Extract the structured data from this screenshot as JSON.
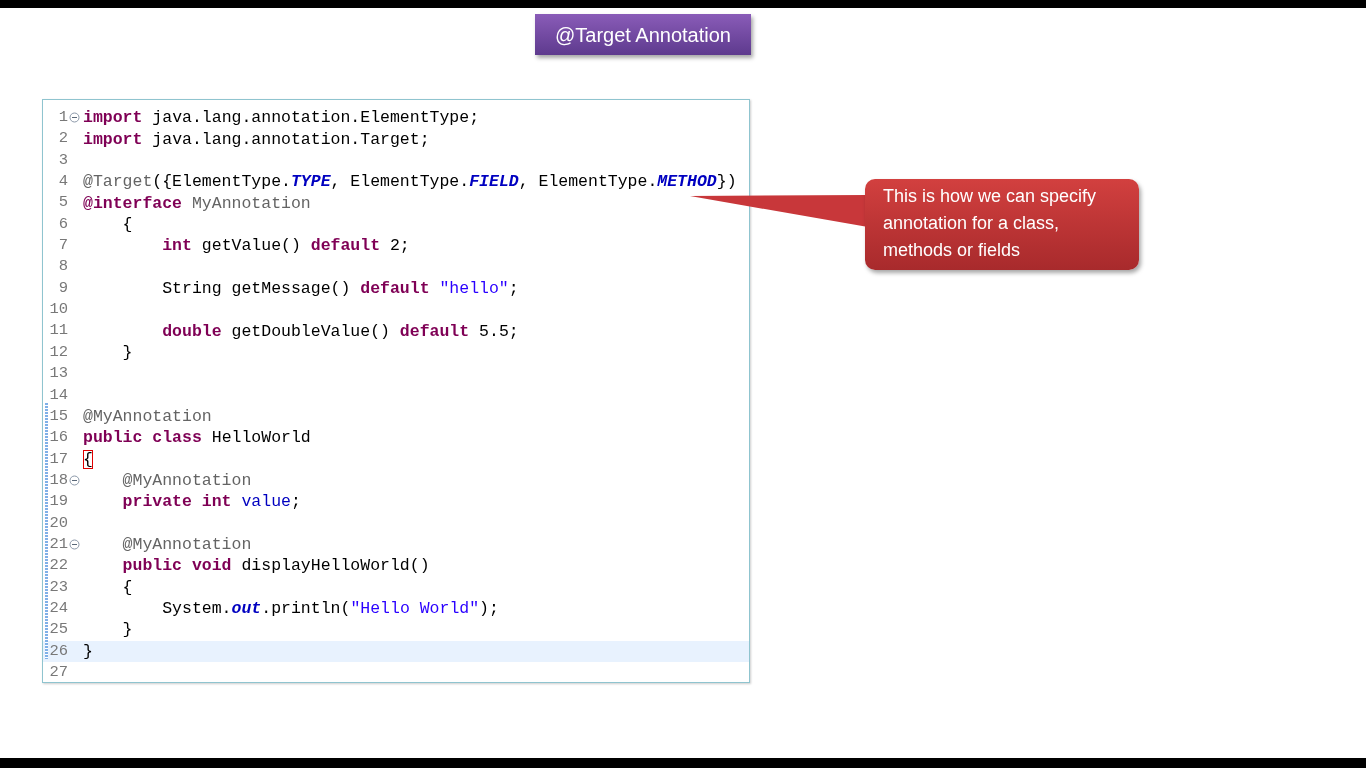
{
  "slide_title": "@Target Annotation",
  "editor": {
    "lines": [
      {
        "number": "1",
        "foldable": true,
        "current": false,
        "tokens": [
          {
            "kind": "keyword",
            "text": "import"
          },
          {
            "kind": "text",
            "text": " java.lang.annotation.ElementType;"
          }
        ]
      },
      {
        "number": "2",
        "foldable": false,
        "current": false,
        "tokens": [
          {
            "kind": "keyword",
            "text": "import"
          },
          {
            "kind": "text",
            "text": " java.lang.annotation.Target;"
          }
        ]
      },
      {
        "number": "3",
        "foldable": false,
        "current": false
      },
      {
        "number": "4",
        "foldable": false,
        "current": false,
        "tokens": [
          {
            "kind": "annotation",
            "text": "@Target"
          },
          {
            "kind": "text",
            "text": "({ElementType."
          },
          {
            "kind": "constant",
            "text": "TYPE"
          },
          {
            "kind": "text",
            "text": ", ElementType."
          },
          {
            "kind": "constant",
            "text": "FIELD"
          },
          {
            "kind": "text",
            "text": ", ElementType."
          },
          {
            "kind": "constant",
            "text": "METHOD"
          },
          {
            "kind": "text",
            "text": "})"
          }
        ]
      },
      {
        "number": "5",
        "foldable": false,
        "current": false,
        "tokens": [
          {
            "kind": "keyword",
            "text": "@interface"
          },
          {
            "kind": "annotation",
            "text": " MyAnnotation"
          }
        ]
      },
      {
        "number": "6",
        "foldable": false,
        "current": false,
        "tokens": [
          {
            "kind": "text",
            "text": "    {"
          }
        ]
      },
      {
        "number": "7",
        "foldable": false,
        "current": false,
        "tokens": [
          {
            "kind": "keyword",
            "text": "        int"
          },
          {
            "kind": "text",
            "text": " getValue() "
          },
          {
            "kind": "keyword",
            "text": "default"
          },
          {
            "kind": "text",
            "text": " 2;"
          }
        ]
      },
      {
        "number": "8",
        "foldable": false,
        "current": false
      },
      {
        "number": "9",
        "foldable": false,
        "current": false,
        "tokens": [
          {
            "kind": "text",
            "text": "        String getMessage() "
          },
          {
            "kind": "keyword",
            "text": "default"
          },
          {
            "kind": "string",
            "text": " \"hello\""
          },
          {
            "kind": "text",
            "text": ";"
          }
        ]
      },
      {
        "number": "10",
        "foldable": false,
        "current": false
      },
      {
        "number": "11",
        "foldable": false,
        "current": false,
        "tokens": [
          {
            "kind": "keyword",
            "text": "        double"
          },
          {
            "kind": "text",
            "text": " getDoubleValue() "
          },
          {
            "kind": "keyword",
            "text": "default"
          },
          {
            "kind": "text",
            "text": " 5.5;"
          }
        ]
      },
      {
        "number": "12",
        "foldable": false,
        "current": false,
        "tokens": [
          {
            "kind": "text",
            "text": "    }"
          }
        ]
      },
      {
        "number": "13",
        "foldable": false,
        "current": false
      },
      {
        "number": "14",
        "foldable": false,
        "current": false
      },
      {
        "number": "15",
        "foldable": false,
        "current": false,
        "tokens": [
          {
            "kind": "annotation",
            "text": "@MyAnnotation"
          }
        ]
      },
      {
        "number": "16",
        "foldable": false,
        "current": false,
        "tokens": [
          {
            "kind": "keyword",
            "text": "public class"
          },
          {
            "kind": "text",
            "text": " HelloWorld"
          }
        ]
      },
      {
        "number": "17",
        "foldable": false,
        "current": false,
        "tokens": [
          {
            "kind": "matched_bracket",
            "text": "{"
          }
        ]
      },
      {
        "number": "18",
        "foldable": true,
        "current": false,
        "tokens": [
          {
            "kind": "annotation",
            "text": "    @MyAnnotation"
          }
        ]
      },
      {
        "number": "19",
        "foldable": false,
        "current": false,
        "tokens": [
          {
            "kind": "keyword",
            "text": "    private int"
          },
          {
            "kind": "field",
            "text": " value"
          },
          {
            "kind": "text",
            "text": ";"
          }
        ]
      },
      {
        "number": "20",
        "foldable": false,
        "current": false
      },
      {
        "number": "21",
        "foldable": true,
        "current": false,
        "tokens": [
          {
            "kind": "annotation",
            "text": "    @MyAnnotation"
          }
        ]
      },
      {
        "number": "22",
        "foldable": false,
        "current": false,
        "tokens": [
          {
            "kind": "keyword",
            "text": "    public void"
          },
          {
            "kind": "text",
            "text": " displayHelloWorld()"
          }
        ]
      },
      {
        "number": "23",
        "foldable": false,
        "current": false,
        "tokens": [
          {
            "kind": "text",
            "text": "    {"
          }
        ]
      },
      {
        "number": "24",
        "foldable": false,
        "current": false,
        "tokens": [
          {
            "kind": "text",
            "text": "        System."
          },
          {
            "kind": "static_field",
            "text": "out"
          },
          {
            "kind": "text",
            "text": ".println("
          },
          {
            "kind": "string",
            "text": "\"Hello World\""
          },
          {
            "kind": "text",
            "text": ");"
          }
        ]
      },
      {
        "number": "25",
        "foldable": false,
        "current": false,
        "tokens": [
          {
            "kind": "text",
            "text": "    }"
          }
        ]
      },
      {
        "number": "26",
        "foldable": false,
        "current": true,
        "tokens": [
          {
            "kind": "text",
            "text": "}"
          }
        ]
      },
      {
        "number": "27",
        "foldable": false,
        "current": false
      }
    ]
  },
  "callout": {
    "text": "This is how we can specify annotation for a class, methods or fields"
  }
}
